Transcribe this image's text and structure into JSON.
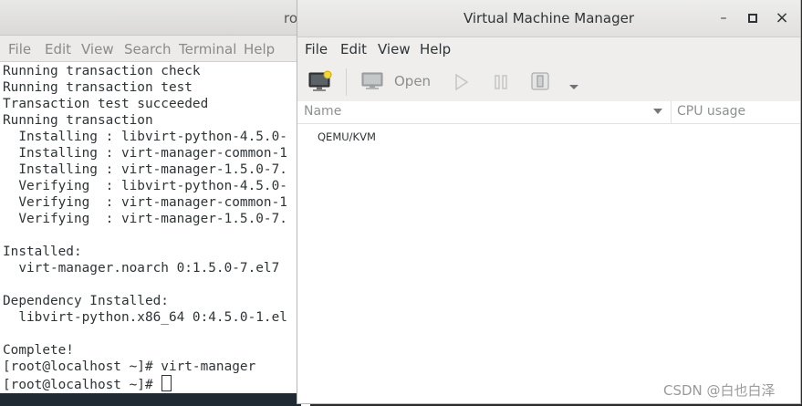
{
  "terminal": {
    "title": "ro",
    "menu": [
      "File",
      "Edit",
      "View",
      "Search",
      "Terminal",
      "Help"
    ],
    "lines": [
      "Running transaction check",
      "Running transaction test",
      "Transaction test succeeded",
      "Running transaction",
      "  Installing : libvirt-python-4.5.0-",
      "  Installing : virt-manager-common-1",
      "  Installing : virt-manager-1.5.0-7.",
      "  Verifying  : libvirt-python-4.5.0-",
      "  Verifying  : virt-manager-common-1",
      "  Verifying  : virt-manager-1.5.0-7.",
      "",
      "Installed:",
      "  virt-manager.noarch 0:1.5.0-7.el7",
      "",
      "Dependency Installed:",
      "  libvirt-python.x86_64 0:4.5.0-1.el",
      "",
      "Complete!",
      "[root@localhost ~]# virt-manager"
    ],
    "prompt": "[root@localhost ~]# "
  },
  "vmm": {
    "title": "Virtual Machine Manager",
    "window_buttons": {
      "minimize": "–",
      "maximize": "□",
      "close": "×"
    },
    "menu": [
      "File",
      "Edit",
      "View",
      "Help"
    ],
    "toolbar": {
      "new_icon": "new-vm-icon",
      "open_label": "Open",
      "run_icon": "play-icon",
      "pause_icon": "pause-icon",
      "shutdown_icon": "shutdown-icon",
      "dropdown_icon": "dropdown-arrow-icon"
    },
    "columns": {
      "name": "Name",
      "cpu": "CPU usage"
    },
    "connections": [
      "QEMU/KVM"
    ]
  },
  "watermark": "CSDN @白也白泽"
}
